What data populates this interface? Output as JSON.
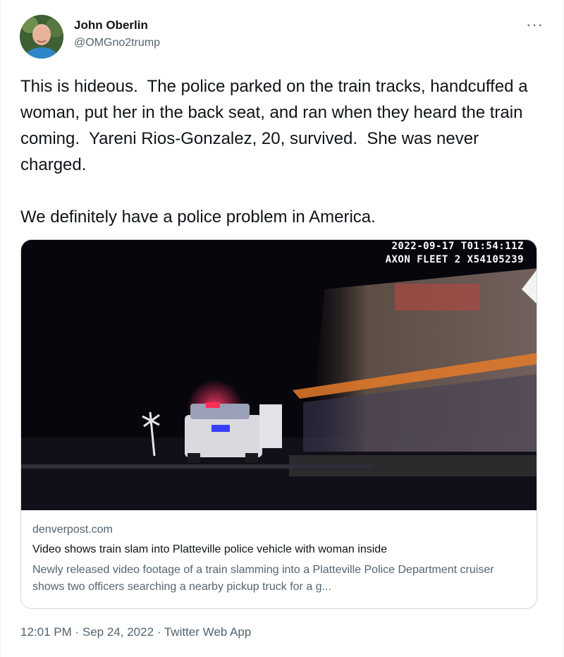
{
  "author": {
    "name": "John Oberlin",
    "handle": "@OMGno2trump"
  },
  "more_icon": "more-horizontal-icon",
  "tweet": {
    "text": "This is hideous.  The police parked on the train tracks, handcuffed a woman, put her in the back seat, and ran when they heard the train coming.  Yareni Rios-Gonzalez, 20, survived.  She was never charged.\n\nWe definitely have a police problem in America."
  },
  "card": {
    "overlay_timestamp": "2022-09-17 T01:54:11Z",
    "overlay_device": "AXON FLEET 2 X54105239",
    "domain": "denverpost.com",
    "title": "Video shows train slam into Platteville police vehicle with woman inside",
    "description": "Newly released video footage of a train slamming into a Platteville Police Department cruiser shows two officers searching a nearby pickup truck for a g..."
  },
  "footer": {
    "time": "12:01 PM",
    "separator": " · ",
    "date": "Sep 24, 2022",
    "source": "Twitter Web App"
  },
  "colors": {
    "text_primary": "#0f1419",
    "text_secondary": "#536471",
    "border": "#cfd9de"
  }
}
